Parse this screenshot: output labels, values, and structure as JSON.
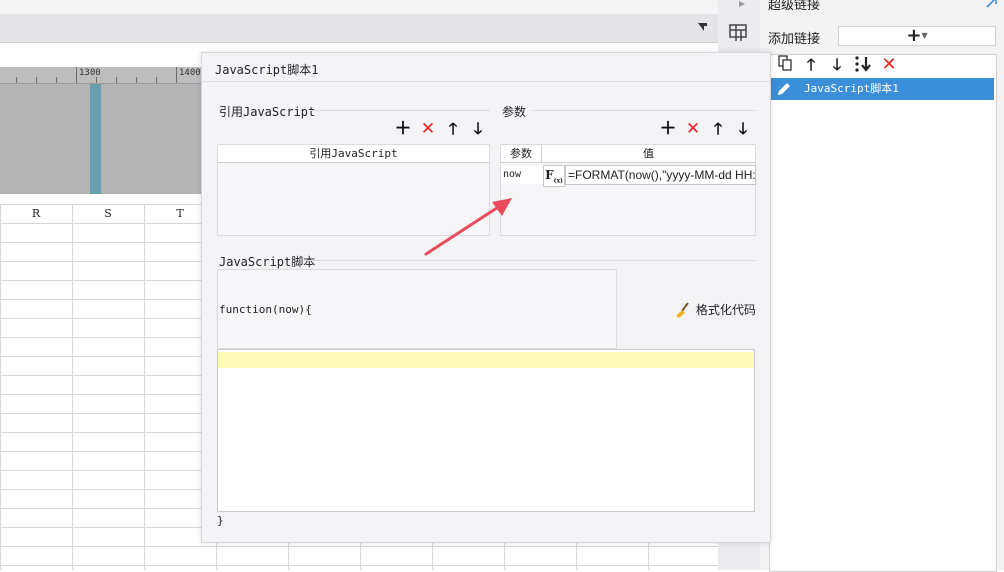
{
  "workspace": {
    "ruler_labels": [
      "1300",
      "1400"
    ],
    "columns": [
      "R",
      "S",
      "T"
    ]
  },
  "dialog": {
    "title": "JavaScript脚本1",
    "ref_section": {
      "label": "引用JavaScript",
      "column_header": "引用JavaScript"
    },
    "param_section": {
      "label": "参数",
      "headers": [
        "参数",
        "值"
      ],
      "rows": [
        {
          "name": "now",
          "formula_btn": "F(x)",
          "value": "=FORMAT(now(),\"yyyy-MM-dd HH:"
        }
      ]
    },
    "script_section": {
      "label": "JavaScript脚本",
      "signature": "function(now){",
      "format_button": "格式化代码",
      "closing": "}"
    },
    "toolbar_icons": [
      "add-icon",
      "delete-icon",
      "move-up-icon",
      "move-down-icon"
    ],
    "colors": {
      "delete": "#e22222",
      "highlight_line": "#fff9b8",
      "arrow": "#ea4b5c"
    }
  },
  "right_panel": {
    "title": "超级链接",
    "add_link_label": "添加链接",
    "add_button": "+",
    "toolbar_icons": [
      "copy-icon",
      "move-up-icon",
      "move-down-icon",
      "sort-icon",
      "delete-icon"
    ],
    "items": [
      {
        "label": "JavaScript脚本1",
        "selected": true
      }
    ],
    "colors": {
      "selected_item": "#3b8fd9"
    }
  }
}
